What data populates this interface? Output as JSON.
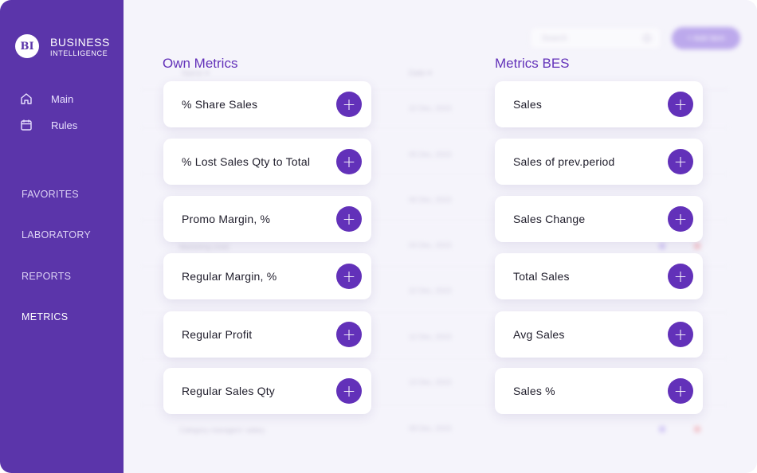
{
  "sidebar": {
    "logo_mark": "BI",
    "logo_title": "BUSINESS",
    "logo_subtitle": "INTELLIGENCE",
    "nav": [
      {
        "label": "Main",
        "icon": "home-icon"
      },
      {
        "label": "Rules",
        "icon": "calendar-icon"
      }
    ],
    "sections": [
      "FAVORITES",
      "LABORATORY",
      "REPORTS",
      "METRICS"
    ],
    "active_section": "METRICS"
  },
  "own_metrics": {
    "title": "Own Metrics",
    "items": [
      "% Share Sales",
      "% Lost Sales Qty to Total",
      "Promo Margin, %",
      "Regular Margin, %",
      "Regular Profit",
      "Regular Sales Qty"
    ]
  },
  "metrics_bes": {
    "title": "Metrics BES",
    "items": [
      "Sales",
      "Sales of prev.period",
      "Sales Change",
      "Total Sales",
      "Avg Sales",
      "Sales %"
    ]
  },
  "add_symbol": "+",
  "colors": {
    "sidebar": "#5b35aa",
    "accent": "#6231b9",
    "background": "#f5f4fb"
  }
}
